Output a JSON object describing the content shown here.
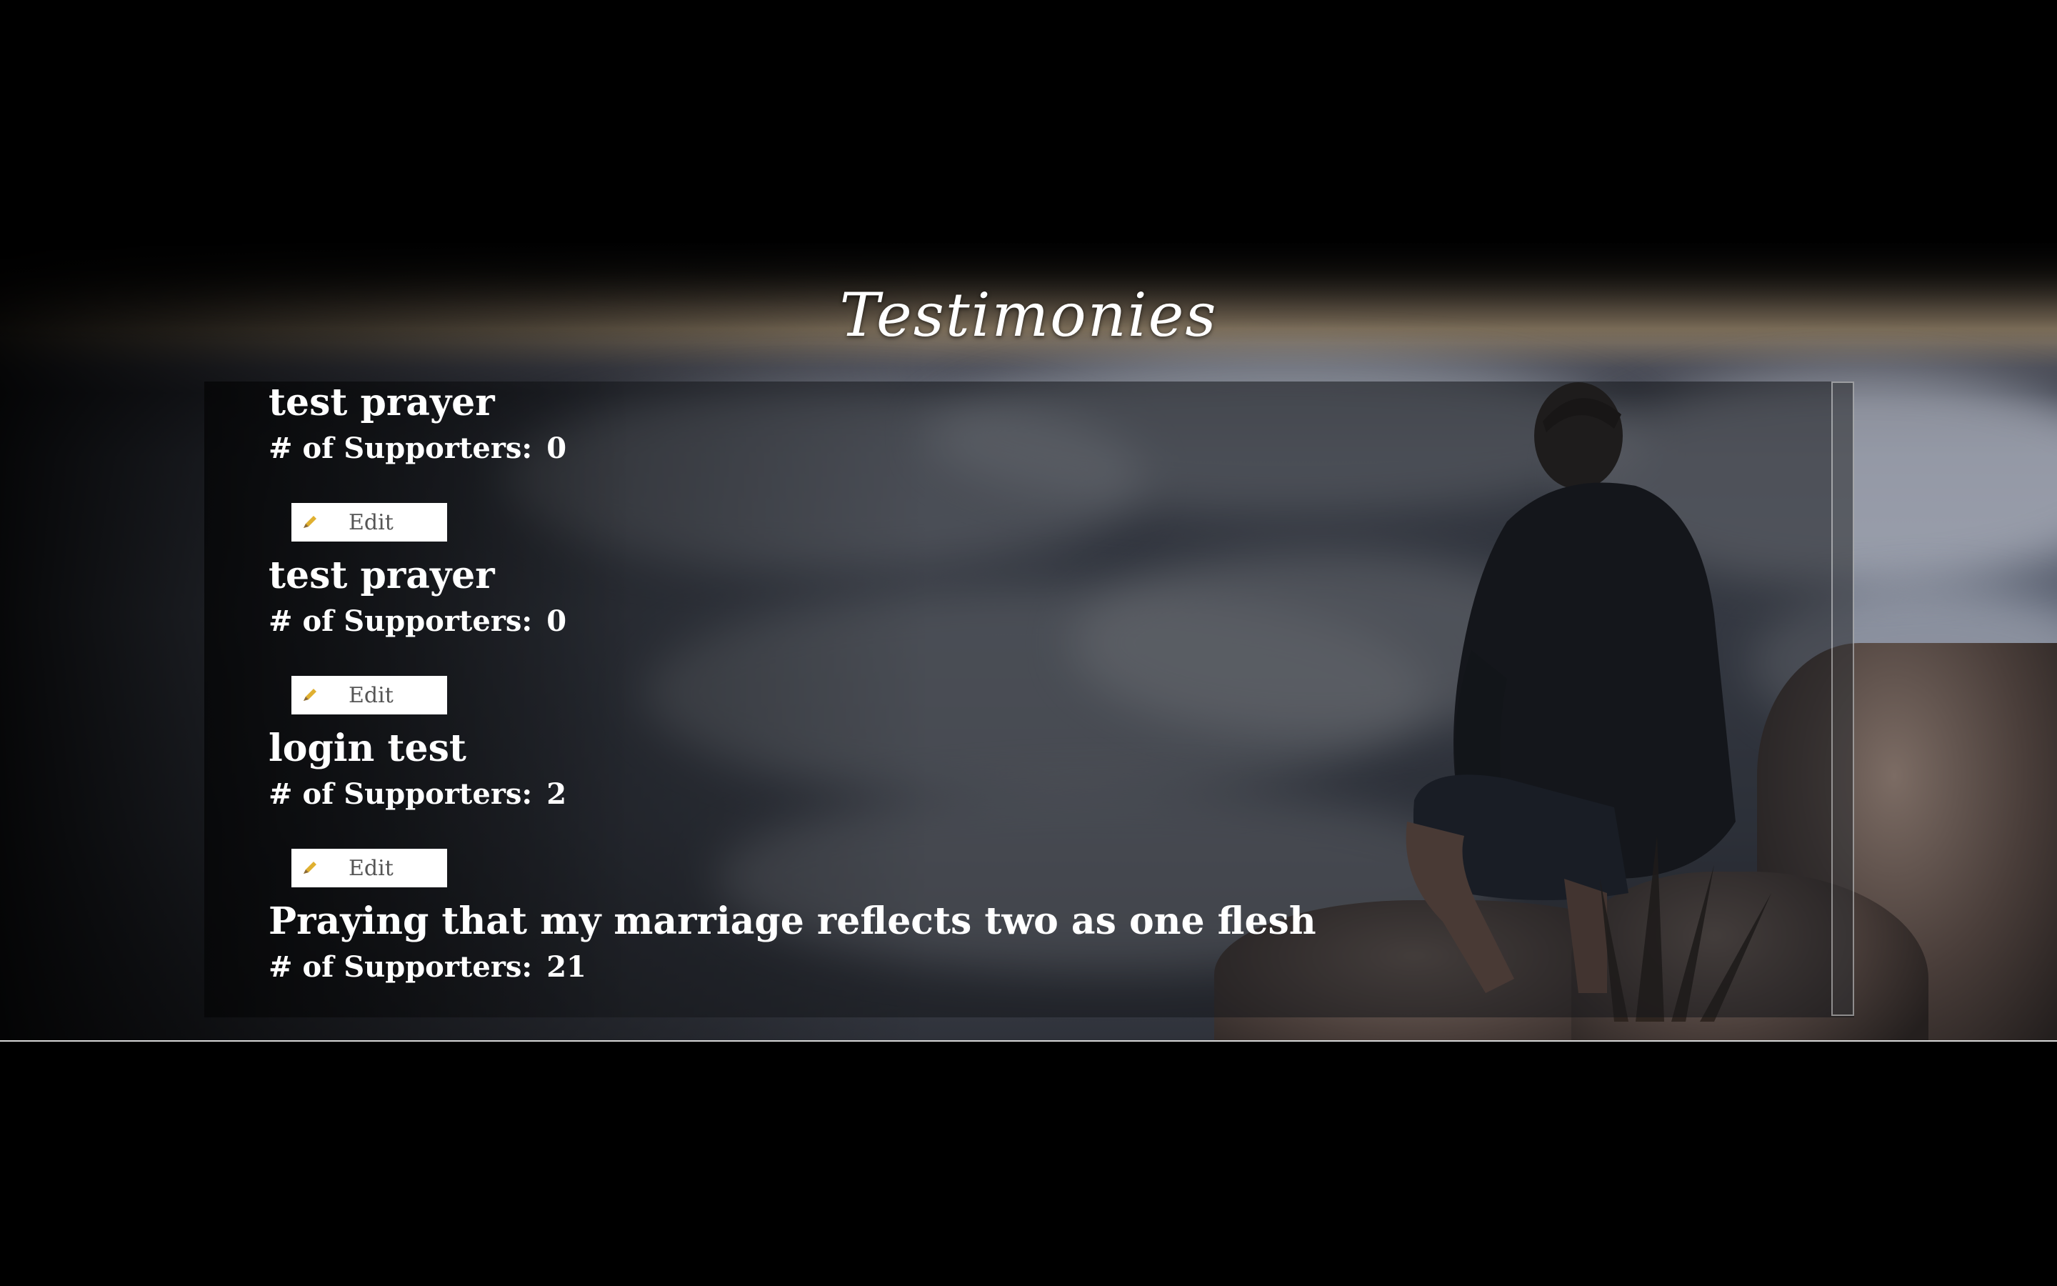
{
  "page": {
    "title": "Testimonies"
  },
  "entries": [
    {
      "title": "test prayer",
      "supporters_label": "# of Supporters:",
      "supporters_count": "0",
      "edit_label": "Edit",
      "has_edit": true
    },
    {
      "title": "test prayer",
      "supporters_label": "# of Supporters:",
      "supporters_count": "0",
      "edit_label": "Edit",
      "has_edit": true
    },
    {
      "title": "login test",
      "supporters_label": "# of Supporters:",
      "supporters_count": "2",
      "edit_label": "Edit",
      "has_edit": true
    },
    {
      "title": "Praying that my marriage reflects two as one flesh",
      "supporters_label": "# of Supporters:",
      "supporters_count": "21",
      "edit_label": "",
      "has_edit": false
    }
  ],
  "icons": {
    "edit": "pencil-icon"
  },
  "colors": {
    "background": "#000000",
    "text": "#ffffff",
    "edit_button_bg": "#ffffff",
    "edit_button_text": "#555555",
    "pencil": "#e0b030"
  }
}
